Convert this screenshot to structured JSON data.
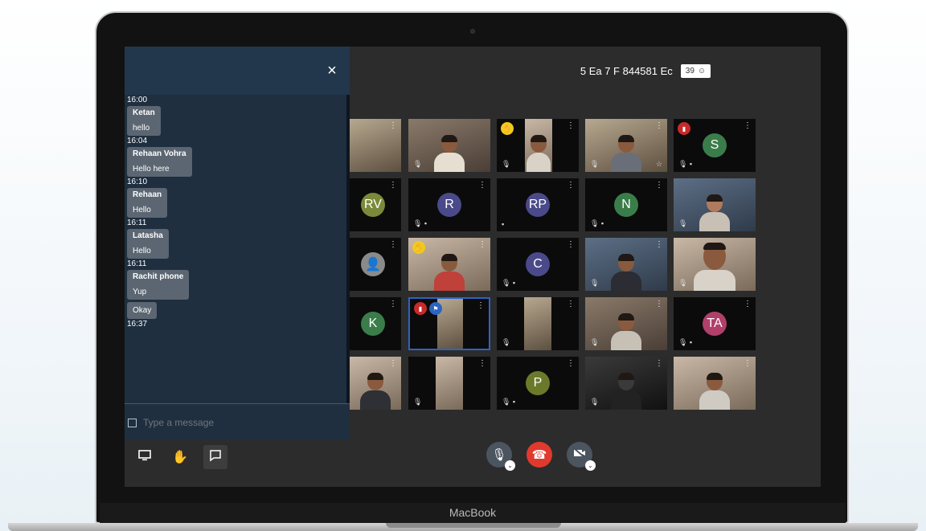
{
  "device": {
    "brand": "MacBook"
  },
  "meeting": {
    "id": "5 Ea 7 F 844581 Ec",
    "participant_count": "39",
    "participants_icon": "people-icon"
  },
  "chat": {
    "close_label": "×",
    "top_time": "16:00",
    "messages": [
      {
        "sender": "Ketan",
        "text": "hello",
        "time": "16:04"
      },
      {
        "sender": "Rehaan Vohra",
        "text": "Hello here",
        "time": "16:10"
      },
      {
        "sender": "Rehaan",
        "text": "Hello",
        "time": "16:11"
      },
      {
        "sender": "Latasha",
        "text": "Hello",
        "time": "16:11"
      },
      {
        "sender": "Rachit phone",
        "text": "Yup",
        "time": ""
      },
      {
        "sender": "",
        "text": "Okay",
        "time": "16:37"
      }
    ],
    "input_placeholder": "Type a message"
  },
  "grid": {
    "tiles": [
      {
        "kind": "video",
        "label": ""
      },
      {
        "kind": "video",
        "label": ""
      },
      {
        "kind": "video",
        "label": ""
      },
      {
        "kind": "video",
        "label": ""
      },
      {
        "kind": "avatar",
        "label": "S",
        "color": "#3a7d4a"
      },
      {
        "kind": "avatar",
        "label": "RV",
        "color": "#7a8a3a"
      },
      {
        "kind": "avatar",
        "label": "R",
        "color": "#4a4a8a"
      },
      {
        "kind": "avatar",
        "label": "RP",
        "color": "#4a4a8a"
      },
      {
        "kind": "avatar",
        "label": "N",
        "color": "#3a7d4a"
      },
      {
        "kind": "video",
        "label": ""
      },
      {
        "kind": "avatar",
        "label": "C",
        "color": "#4a4a8a"
      },
      {
        "kind": "avatar",
        "label": "K",
        "color": "#3a7d4a"
      },
      {
        "kind": "avatar",
        "label": "TA",
        "color": "#b0406a"
      },
      {
        "kind": "avatar",
        "label": "P",
        "color": "#6a7a2a"
      }
    ]
  },
  "toolbar": {
    "left": [
      "screen-share-icon",
      "raise-hand-icon",
      "chat-icon"
    ],
    "center": [
      "microphone-muted-icon",
      "end-call-icon",
      "camera-off-icon"
    ]
  },
  "colors": {
    "chat_bg": "#1f2f40",
    "end_call": "#e03a2e",
    "selected_border": "#2a64c4"
  }
}
